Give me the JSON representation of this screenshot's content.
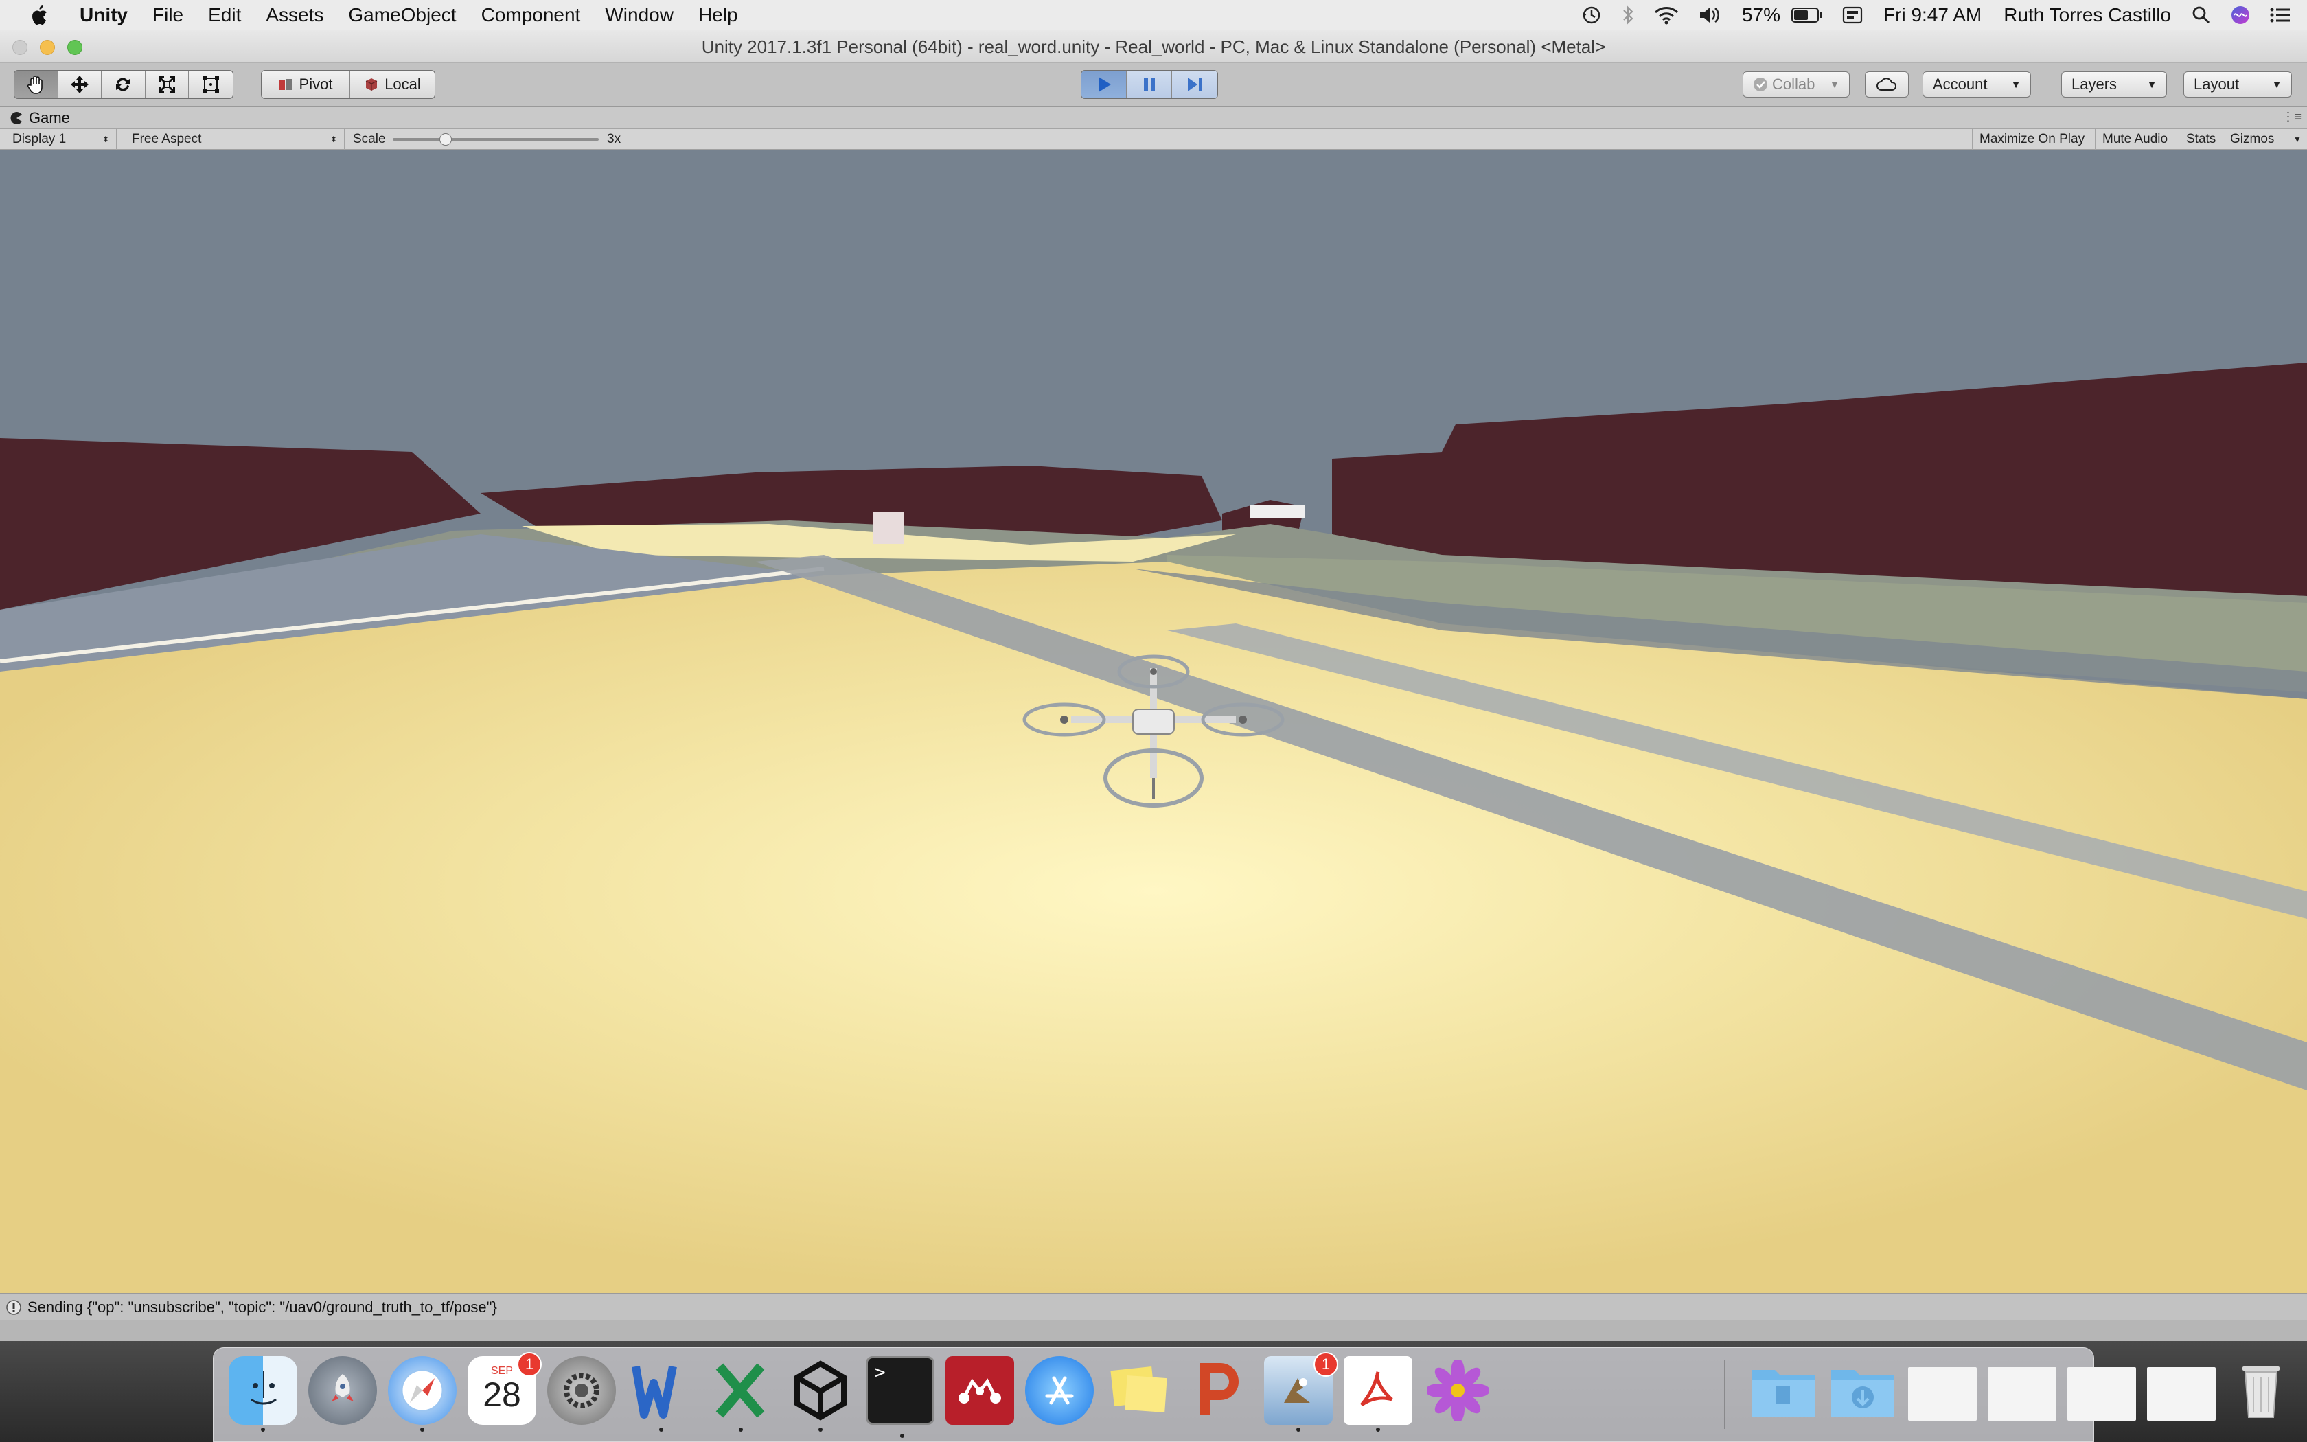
{
  "menubar": {
    "app_name": "Unity",
    "menus": [
      "File",
      "Edit",
      "Assets",
      "GameObject",
      "Component",
      "Window",
      "Help"
    ],
    "battery": "57%",
    "clock": "Fri 9:47 AM",
    "user": "Ruth Torres Castillo"
  },
  "window": {
    "title": "Unity 2017.1.3f1 Personal (64bit) - real_word.unity - Real_world - PC, Mac & Linux Standalone (Personal) <Metal>"
  },
  "toolbar": {
    "pivot_label": "Pivot",
    "local_label": "Local",
    "collab_label": "Collab",
    "account_label": "Account",
    "layers_label": "Layers",
    "layout_label": "Layout",
    "play_active": true
  },
  "game_panel": {
    "tab_label": "Game",
    "display": "Display 1",
    "aspect": "Free Aspect",
    "scale_label": "Scale",
    "scale_value": "3x",
    "maximize_label": "Maximize On Play",
    "mute_label": "Mute Audio",
    "stats_label": "Stats",
    "gizmos_label": "Gizmos"
  },
  "status": {
    "message": "Sending {\"op\": \"unsubscribe\", \"topic\": \"/uav0/ground_truth_to_tf/pose\"}"
  },
  "dock": {
    "calendar_month": "SEP",
    "calendar_day": "28",
    "calendar_badge": "1",
    "mail_badge": "1",
    "apps": [
      "finder-icon",
      "launchpad-icon",
      "safari-icon",
      "calendar-icon",
      "system-preferences-icon",
      "word-icon",
      "excel-icon",
      "unity-icon",
      "terminal-icon",
      "mendeley-icon",
      "app-store-icon",
      "stickies-icon",
      "powerpoint-icon",
      "mail-icon",
      "acrobat-icon",
      "flower-icon"
    ]
  },
  "colors": {
    "sky": "#76828f",
    "ground": "#f0dd9a",
    "building": "#4c242b",
    "play_blue": "#4a7fd0"
  }
}
